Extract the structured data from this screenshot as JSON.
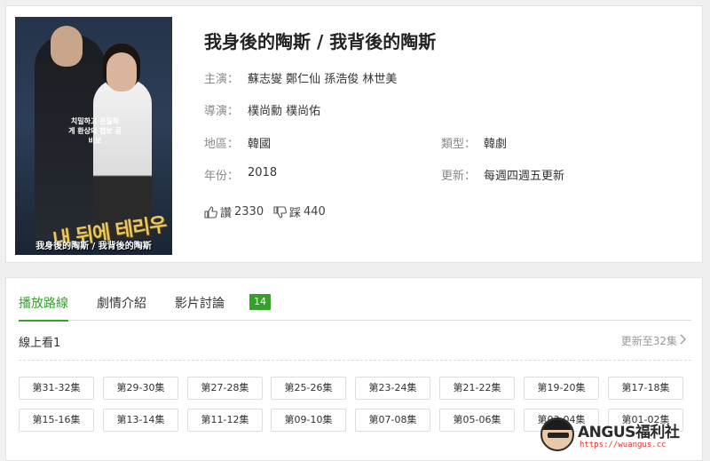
{
  "show": {
    "title": "我身後的陶斯 / 我背後的陶斯",
    "poster_caption": "我身後的陶斯 / 我背後的陶斯",
    "poster_korean": "내 뒤에 테리우스",
    "poster_tagline": "치밀하고 은밀하게 환상의 첩보 콤비보",
    "cast_label": "主演：",
    "cast": "蘇志燮 鄭仁仙 孫浩俊 林世美",
    "director_label": "導演：",
    "director": "樸尚勳 樸尚佑",
    "region_label": "地區：",
    "region": "韓國",
    "genre_label": "類型：",
    "genre": "韓劇",
    "year_label": "年份：",
    "year": "2018",
    "update_label": "更新：",
    "update": "每週四週五更新",
    "like_label": "讚",
    "like_count": "2330",
    "dislike_label": "踩",
    "dislike_count": "440"
  },
  "tabs": [
    {
      "label": "播放路線"
    },
    {
      "label": "劇情介紹"
    },
    {
      "label": "影片討論"
    }
  ],
  "discussion_count": "14",
  "source": {
    "label": "線上看1",
    "update_text": "更新至32集"
  },
  "episodes": [
    "第31-32集",
    "第29-30集",
    "第27-28集",
    "第25-26集",
    "第23-24集",
    "第21-22集",
    "第19-20集",
    "第17-18集",
    "第15-16集",
    "第13-14集",
    "第11-12集",
    "第09-10集",
    "第07-08集",
    "第05-06集",
    "第03-04集",
    "第01-02集"
  ],
  "watermark": {
    "brand": "ANGUS福利社",
    "url": "https://wuangus.cc"
  },
  "colors": {
    "accent": "#35a02c"
  }
}
